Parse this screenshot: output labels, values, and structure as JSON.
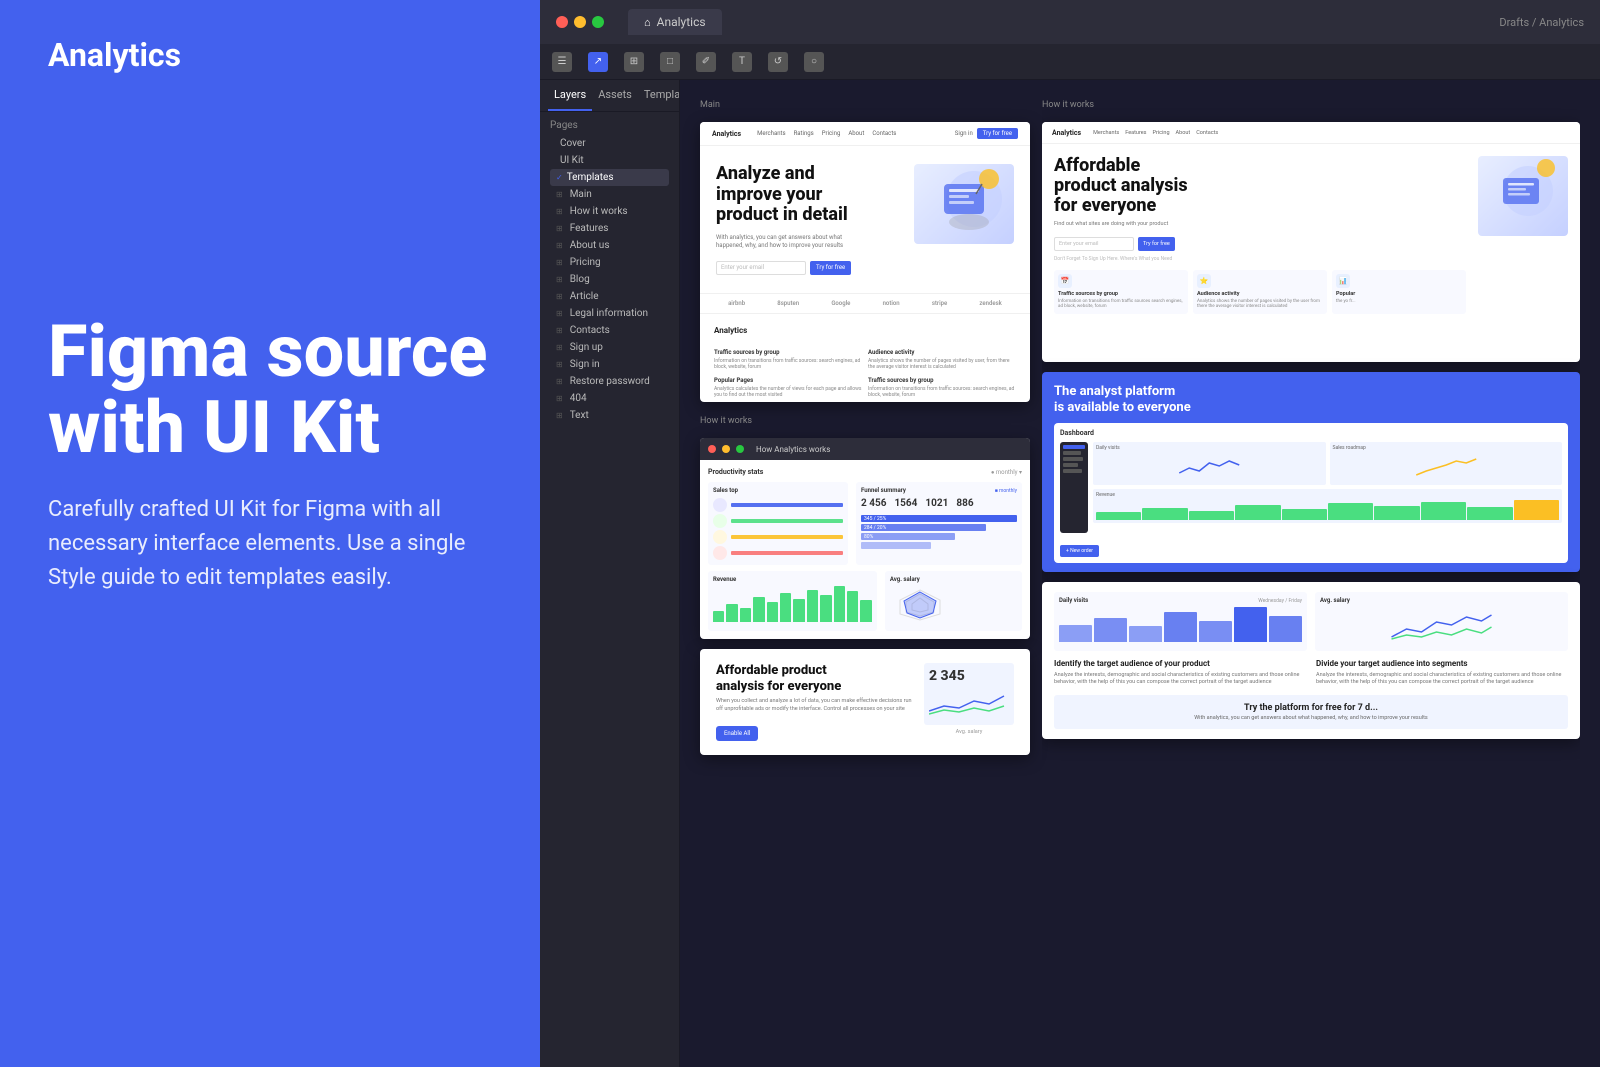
{
  "header": {
    "logo": "Analytics"
  },
  "hero": {
    "heading": "Figma source\nwith UI Kit",
    "subtext": "Carefully crafted UI Kit for Figma with all necessary interface elements. Use a single Style guide to edit templates easily."
  },
  "figma": {
    "tab_title": "Analytics",
    "breadcrumb": "Drafts / Analytics",
    "toolbar": {
      "tools": [
        "☰",
        "⊞",
        "□",
        "+",
        "T",
        "↺",
        "○"
      ]
    },
    "sidebar": {
      "tabs": [
        "Layers",
        "Assets",
        "Templates"
      ],
      "pages_label": "Pages",
      "pages": [
        {
          "label": "Cover"
        },
        {
          "label": "UI Kit"
        },
        {
          "label": "Templates",
          "active": true
        },
        {
          "label": "Main"
        },
        {
          "label": "How it works"
        },
        {
          "label": "Features"
        },
        {
          "label": "About us"
        },
        {
          "label": "Pricing"
        },
        {
          "label": "Blog"
        },
        {
          "label": "Article"
        },
        {
          "label": "Legal information"
        },
        {
          "label": "Contacts"
        },
        {
          "label": "Sign up"
        },
        {
          "label": "Sign in"
        },
        {
          "label": "Restore password"
        },
        {
          "label": "404"
        },
        {
          "label": "Text"
        }
      ]
    },
    "main_page": {
      "section_label": "Main",
      "nav_logo": "Analytics",
      "nav_links": [
        "Merchants",
        "Ratings",
        "Pricing",
        "About",
        "Contacts"
      ],
      "nav_cta": "Try for free",
      "hero_heading": "Analyze and improve your product in detail",
      "hero_desc": "With analytics, you can get answers about what happened, why, and how to improve your results",
      "input_placeholder": "Enter your email",
      "cta_btn": "Try for free",
      "brands": [
        "airbnb",
        "8sputen",
        "Google",
        "notion",
        "stripe",
        "zendesk"
      ],
      "analytics_section_title": "Analytics",
      "features": [
        {
          "title": "Traffic sources by group",
          "desc": "Information on transitions from traffic sources: search engines, ad block, website, forum"
        },
        {
          "title": "Audience activity",
          "desc": "Analytics shows the number of pages visited by user, from there the average visitor interest is calculated"
        },
        {
          "title": "Popular Pages",
          "desc": "Analytics calculates the number of views for each page and allows you to find out the most visited"
        },
        {
          "title": "Traffic sources by group",
          "desc": "Information on transitions from traffic sources: search engines, ad block, website, forum"
        }
      ]
    },
    "how_it_works": {
      "section_label": "How it works",
      "heading": "How Analytics works",
      "dashboard": {
        "title": "Productivity stats",
        "sales_top": "Sales top",
        "funnel_title": "Funnel summary",
        "stats": [
          {
            "value": "2 456",
            "label": ""
          },
          {
            "value": "1564",
            "label": ""
          },
          {
            "value": "1021",
            "label": ""
          },
          {
            "value": "886",
            "label": ""
          }
        ],
        "revenue_title": "Revenue",
        "avg_salary_title": "Avg. salary"
      }
    },
    "side_page": {
      "hero_heading": "Affordable product analysis for everyone",
      "platform_heading": "The analyst platform is available to everyone",
      "daily_visits_title": "Daily visits",
      "avg_salary_title": "Avg. salary",
      "target_audience_title": "Identify the target audience of your product",
      "target_audience_desc": "Analyze the interests, demographic and social characteristics of existing customers and those online behavior, with the help of this you can compose the correct portrait of the target audience",
      "segments_title": "Divide your target audience into segments",
      "segments_desc": "Analyze the interests, demographic and social characteristics of existing customers and those online behavior, with the help of this you can compose the correct portrait",
      "cta": "Try the platform for free for 7 d...",
      "cta_sub": "With analytics, you can get answers about what happened, why, and how to improve your results"
    }
  },
  "colors": {
    "primary": "#4361ee",
    "dark_bg": "#1a1a2e",
    "sidebar_bg": "#252530",
    "bar_green": "#4ade80",
    "bar_blue": "#4361ee",
    "bar_yellow": "#fbbf24",
    "bar_light": "#93c5fd"
  }
}
